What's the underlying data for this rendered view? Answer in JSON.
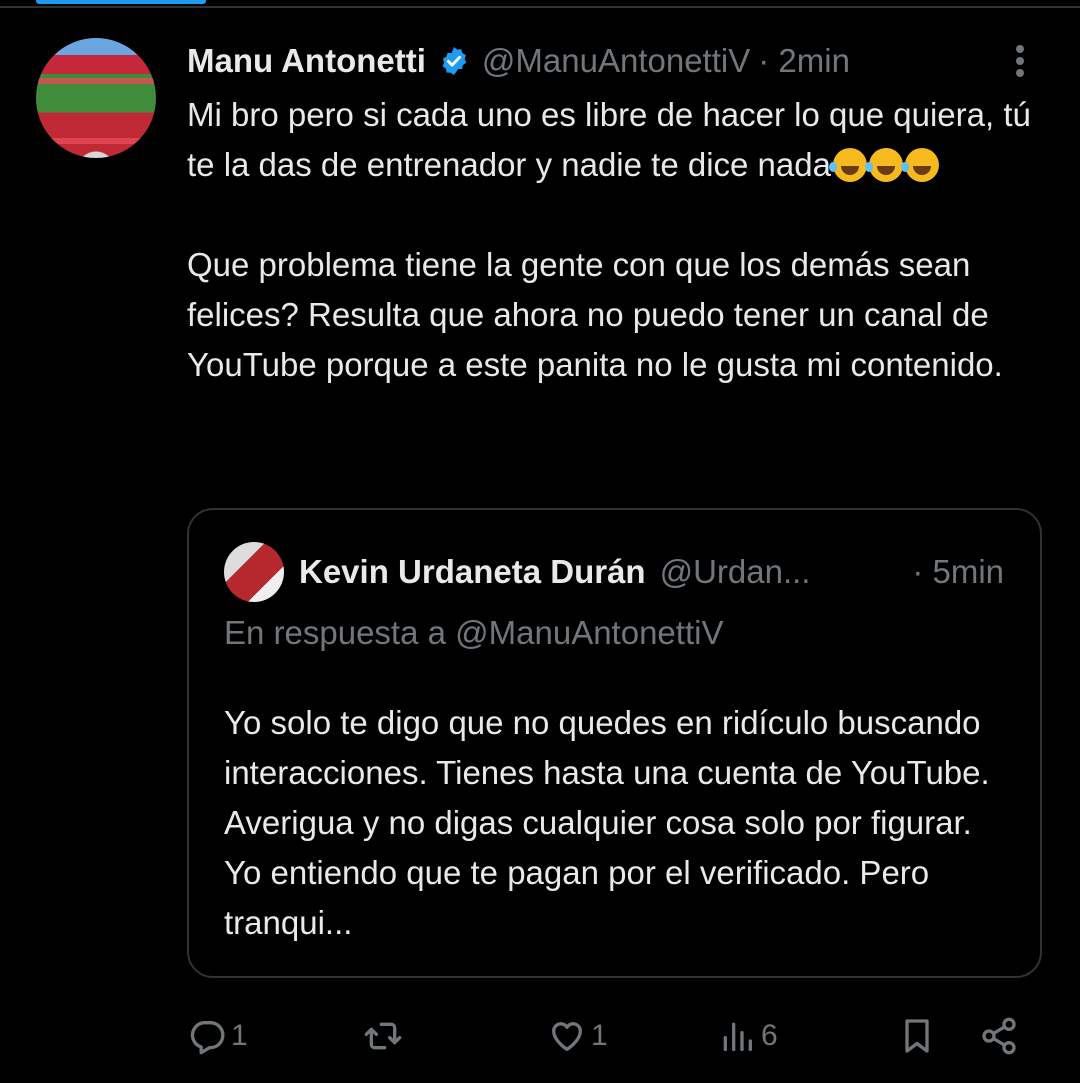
{
  "tweet": {
    "author_name": "Manu Antonetti",
    "author_handle": "@ManuAntonettiV",
    "time": "· 2min",
    "paragraph1": "Mi bro pero si cada uno es libre de hacer lo que quiera, tú te la das de entrenador y nadie te dice nada",
    "paragraph2": "Que problema tiene la gente con que los demás sean felices? Resulta que ahora no puedo tener un canal de YouTube porque a este panita no le gusta mi contenido."
  },
  "quoted": {
    "author_name": "Kevin Urdaneta Durán",
    "author_handle": "@Urdan...",
    "time": "· 5min",
    "reply_to": "En respuesta a @ManuAntonettiV",
    "text": "Yo solo te digo que no quedes en ridículo buscando interacciones. Tienes hasta una cuenta de YouTube. Averigua y no digas cualquier cosa solo por figurar. Yo entiendo que te pagan por el verificado. Pero tranqui..."
  },
  "actions": {
    "reply_count": "1",
    "like_count": "1",
    "views_count": "6"
  },
  "icons": [
    "verified-badge-icon",
    "more-icon",
    "reply-icon",
    "repost-icon",
    "like-icon",
    "views-icon",
    "bookmark-icon",
    "share-icon",
    "laughing-emoji-icon"
  ],
  "colors": {
    "background": "#000000",
    "text": "#e7e9ea",
    "muted": "#71767b",
    "accent": "#1d9bf0"
  }
}
